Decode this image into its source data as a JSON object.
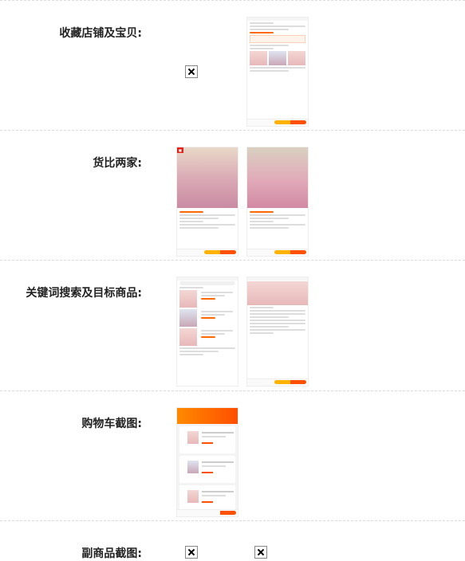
{
  "sections": [
    {
      "key": "favorites",
      "label": "收藏店铺及宝贝:"
    },
    {
      "key": "compare",
      "label": "货比两家:"
    },
    {
      "key": "search",
      "label": "关键词搜索及目标商品:"
    },
    {
      "key": "cart",
      "label": "购物车截图:"
    },
    {
      "key": "sub_product",
      "label": "副商品截图:"
    }
  ],
  "icons": {
    "broken_image": "broken-image-icon"
  },
  "colors": {
    "accent_orange": "#ff5000",
    "accent_yellow": "#ffb300",
    "separator": "#dddddd"
  }
}
